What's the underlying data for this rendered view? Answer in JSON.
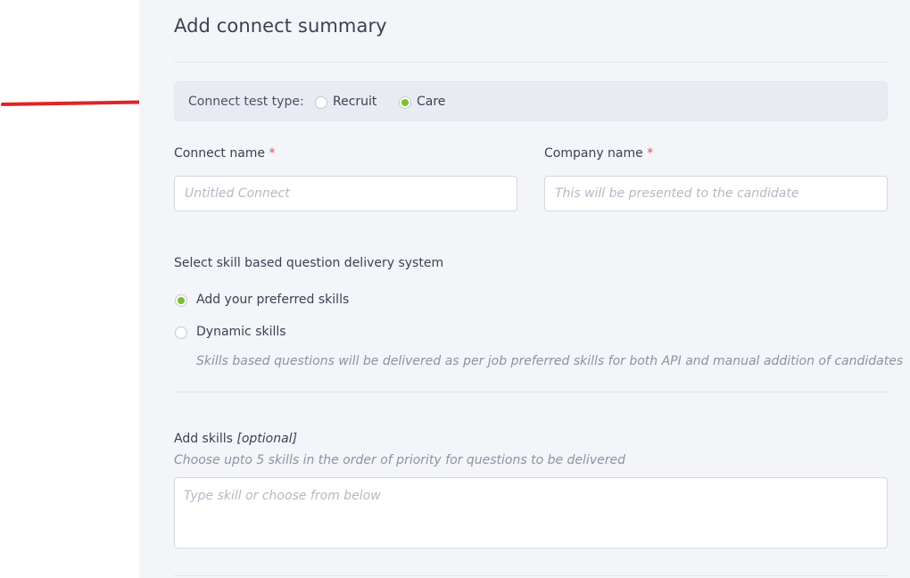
{
  "page": {
    "title": "Add connect summary"
  },
  "connect_type": {
    "label": "Connect test type:",
    "options": [
      {
        "label": "Recruit",
        "selected": false
      },
      {
        "label": "Care",
        "selected": true
      }
    ]
  },
  "form": {
    "connect_name": {
      "label": "Connect name",
      "required_mark": "*",
      "placeholder": "Untitled Connect",
      "value": ""
    },
    "company_name": {
      "label": "Company name",
      "required_mark": "*",
      "placeholder": "This will be presented to the candidate",
      "value": ""
    }
  },
  "skill_delivery": {
    "question": "Select skill based question delivery system",
    "options": [
      {
        "label": "Add your preferred skills",
        "selected": true
      },
      {
        "label": "Dynamic skills",
        "selected": false
      }
    ],
    "dynamic_hint": "Skills based questions will be delivered as per job preferred skills for both API and manual addition of candidates"
  },
  "skills": {
    "label": "Add skills",
    "optional": "[optional]",
    "hint": "Choose upto 5 skills in the order of priority for questions to be delivered",
    "placeholder": "Type skill or choose from below"
  },
  "colors": {
    "accent_green": "#7cc227",
    "annotation_red": "#e02424",
    "required_red": "#e0504f",
    "panel_bg": "#f3f5f9"
  },
  "annotation": {
    "icon": "red-arrow-icon"
  }
}
